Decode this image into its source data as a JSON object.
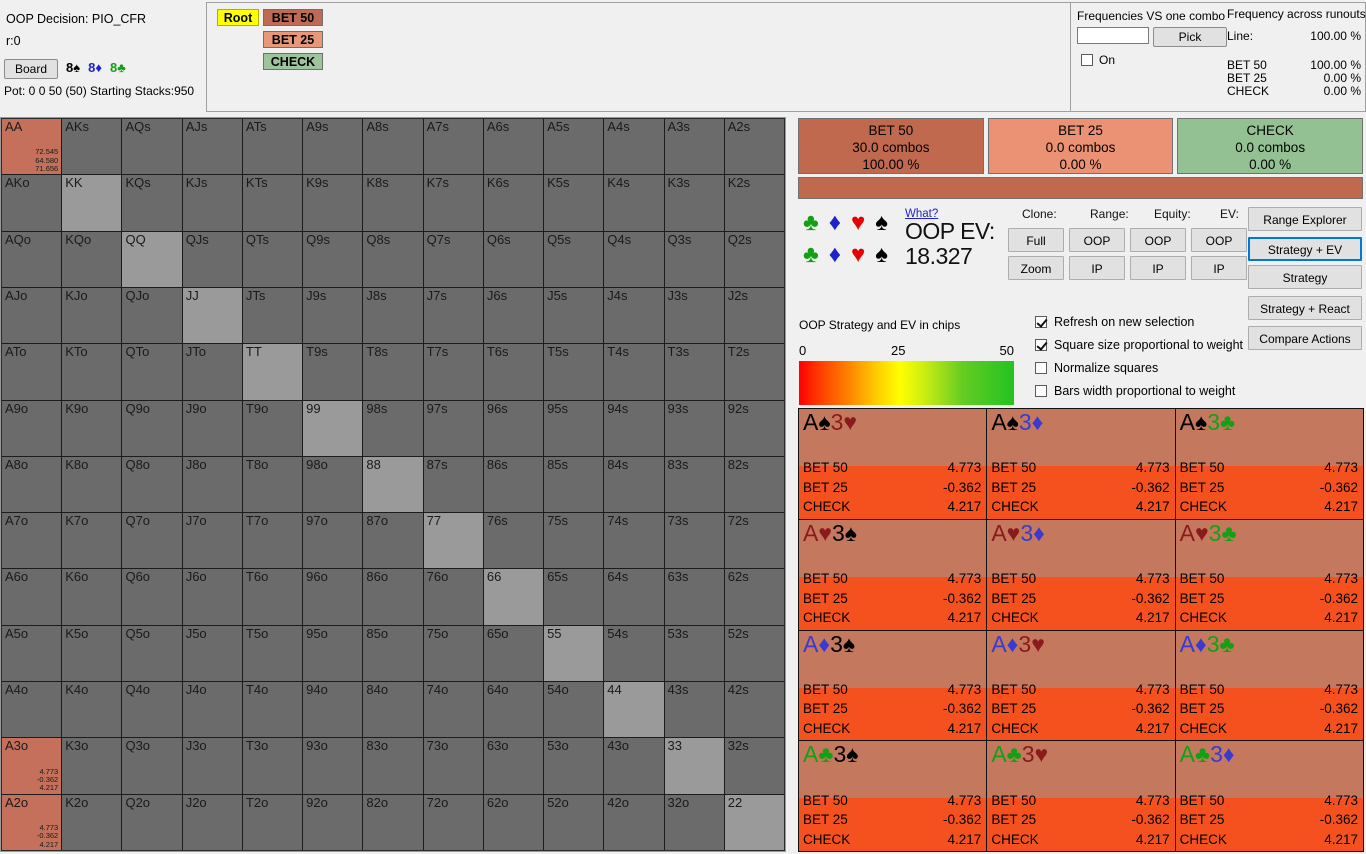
{
  "header": {
    "oop_decision": "OOP Decision:  PIO_CFR",
    "r_line": "r:0",
    "board_button": "Board",
    "board_cards": [
      {
        "rank": "8",
        "suit": "♠",
        "color": "spade"
      },
      {
        "rank": "8",
        "suit": "♦",
        "color": "diamond"
      },
      {
        "rank": "8",
        "suit": "♣",
        "color": "club"
      }
    ],
    "pot_line": "Pot: 0 0 50 (50) Starting Stacks:950"
  },
  "tree": {
    "root": "Root",
    "bet50": "BET 50",
    "bet25": "BET 25",
    "check": "CHECK"
  },
  "frequencies": {
    "vs_one_combo_label": "Frequencies VS one combo",
    "input_value": "",
    "input_placeholder": "",
    "pick_button": "Pick",
    "on_label": "On",
    "on_checked": false,
    "across_runouts_label": "Frequency across runouts:",
    "line_label": "Line:",
    "line_value": "100.00 %",
    "rows": [
      {
        "label": "BET 50",
        "value": "100.00 %"
      },
      {
        "label": "BET 25",
        "value": "0.00 %"
      },
      {
        "label": "CHECK",
        "value": "0.00 %"
      }
    ]
  },
  "action_summary": [
    {
      "name": "BET 50",
      "combos": "30.0 combos",
      "pct": "100.00 %",
      "color": "#c0694f"
    },
    {
      "name": "BET 25",
      "combos": "0.0 combos",
      "pct": "0.00 %",
      "color": "#ea9273"
    },
    {
      "name": "CHECK",
      "combos": "0.0 combos",
      "pct": "0.00 %",
      "color": "#93c193"
    }
  ],
  "ev_panel": {
    "what_link": "What?",
    "oop_ev_label": "OOP EV:",
    "oop_ev_value": "18.327",
    "caption": "OOP Strategy and EV in chips",
    "scale_min": "0",
    "scale_mid": "25",
    "scale_max": "50"
  },
  "column_headers": {
    "clone": "Clone:",
    "range": "Range:",
    "equity": "Equity:",
    "ev": "EV:"
  },
  "grid_buttons": {
    "full": "Full",
    "zoom": "Zoom",
    "range_oop": "OOP",
    "range_ip": "IP",
    "equity_oop": "OOP",
    "equity_ip": "IP",
    "ev_oop": "OOP",
    "ev_ip": "IP"
  },
  "side_buttons": [
    {
      "label": "Range Explorer",
      "selected": false
    },
    {
      "label": "Strategy + EV",
      "selected": true
    },
    {
      "label": "Strategy",
      "selected": false
    },
    {
      "label": "Strategy + React",
      "selected": false
    },
    {
      "label": "Compare Actions",
      "selected": false
    }
  ],
  "checkboxes": [
    {
      "label": "Refresh on new selection",
      "checked": true
    },
    {
      "label": "Square size proportional to weight",
      "checked": true
    },
    {
      "label": "Normalize squares",
      "checked": false
    },
    {
      "label": "Bars width proportional to weight",
      "checked": false
    }
  ],
  "matrix": {
    "rows": [
      [
        "AA",
        "AKs",
        "AQs",
        "AJs",
        "ATs",
        "A9s",
        "A8s",
        "A7s",
        "A6s",
        "A5s",
        "A4s",
        "A3s",
        "A2s"
      ],
      [
        "AKo",
        "KK",
        "KQs",
        "KJs",
        "KTs",
        "K9s",
        "K8s",
        "K7s",
        "K6s",
        "K5s",
        "K4s",
        "K3s",
        "K2s"
      ],
      [
        "AQo",
        "KQo",
        "QQ",
        "QJs",
        "QTs",
        "Q9s",
        "Q8s",
        "Q7s",
        "Q6s",
        "Q5s",
        "Q4s",
        "Q3s",
        "Q2s"
      ],
      [
        "AJo",
        "KJo",
        "QJo",
        "JJ",
        "JTs",
        "J9s",
        "J8s",
        "J7s",
        "J6s",
        "J5s",
        "J4s",
        "J3s",
        "J2s"
      ],
      [
        "ATo",
        "KTo",
        "QTo",
        "JTo",
        "TT",
        "T9s",
        "T8s",
        "T7s",
        "T6s",
        "T5s",
        "T4s",
        "T3s",
        "T2s"
      ],
      [
        "A9o",
        "K9o",
        "Q9o",
        "J9o",
        "T9o",
        "99",
        "98s",
        "97s",
        "96s",
        "95s",
        "94s",
        "93s",
        "92s"
      ],
      [
        "A8o",
        "K8o",
        "Q8o",
        "J8o",
        "T8o",
        "98o",
        "88",
        "87s",
        "86s",
        "85s",
        "84s",
        "83s",
        "82s"
      ],
      [
        "A7o",
        "K7o",
        "Q7o",
        "J7o",
        "T7o",
        "97o",
        "87o",
        "77",
        "76s",
        "75s",
        "74s",
        "73s",
        "72s"
      ],
      [
        "A6o",
        "K6o",
        "Q6o",
        "J6o",
        "T6o",
        "96o",
        "86o",
        "76o",
        "66",
        "65s",
        "64s",
        "63s",
        "62s"
      ],
      [
        "A5o",
        "K5o",
        "Q5o",
        "J5o",
        "T5o",
        "95o",
        "85o",
        "75o",
        "65o",
        "55",
        "54s",
        "53s",
        "52s"
      ],
      [
        "A4o",
        "K4o",
        "Q4o",
        "J4o",
        "T4o",
        "94o",
        "84o",
        "74o",
        "64o",
        "54o",
        "44",
        "43s",
        "42s"
      ],
      [
        "A3o",
        "K3o",
        "Q3o",
        "J3o",
        "T3o",
        "93o",
        "83o",
        "73o",
        "63o",
        "53o",
        "43o",
        "33",
        "32s"
      ],
      [
        "A2o",
        "K2o",
        "Q2o",
        "J2o",
        "T2o",
        "92o",
        "82o",
        "72o",
        "62o",
        "52o",
        "42o",
        "32o",
        "22"
      ]
    ],
    "highlighted": {
      "AA": [
        "72.545",
        "64.580",
        "71.656"
      ],
      "A3o": [
        "4.773",
        "-0.362",
        "4.217"
      ],
      "A2o": [
        "4.773",
        "-0.362",
        "4.217"
      ]
    }
  },
  "combos": [
    {
      "r1": "A",
      "s1": "♠",
      "c1": "spade",
      "r2": "3",
      "s2": "♥",
      "c2": "heart",
      "rows": [
        {
          "l": "BET 50",
          "v": "4.773"
        },
        {
          "l": "BET 25",
          "v": "-0.362"
        },
        {
          "l": "CHECK",
          "v": "4.217"
        }
      ]
    },
    {
      "r1": "A",
      "s1": "♠",
      "c1": "spade",
      "r2": "3",
      "s2": "♦",
      "c2": "diamond",
      "rows": [
        {
          "l": "BET 50",
          "v": "4.773"
        },
        {
          "l": "BET 25",
          "v": "-0.362"
        },
        {
          "l": "CHECK",
          "v": "4.217"
        }
      ]
    },
    {
      "r1": "A",
      "s1": "♠",
      "c1": "spade",
      "r2": "3",
      "s2": "♣",
      "c2": "club",
      "rows": [
        {
          "l": "BET 50",
          "v": "4.773"
        },
        {
          "l": "BET 25",
          "v": "-0.362"
        },
        {
          "l": "CHECK",
          "v": "4.217"
        }
      ]
    },
    {
      "r1": "A",
      "s1": "♥",
      "c1": "heart",
      "r2": "3",
      "s2": "♠",
      "c2": "spade",
      "rows": [
        {
          "l": "BET 50",
          "v": "4.773"
        },
        {
          "l": "BET 25",
          "v": "-0.362"
        },
        {
          "l": "CHECK",
          "v": "4.217"
        }
      ]
    },
    {
      "r1": "A",
      "s1": "♥",
      "c1": "heart",
      "r2": "3",
      "s2": "♦",
      "c2": "diamond",
      "rows": [
        {
          "l": "BET 50",
          "v": "4.773"
        },
        {
          "l": "BET 25",
          "v": "-0.362"
        },
        {
          "l": "CHECK",
          "v": "4.217"
        }
      ]
    },
    {
      "r1": "A",
      "s1": "♥",
      "c1": "heart",
      "r2": "3",
      "s2": "♣",
      "c2": "club",
      "rows": [
        {
          "l": "BET 50",
          "v": "4.773"
        },
        {
          "l": "BET 25",
          "v": "-0.362"
        },
        {
          "l": "CHECK",
          "v": "4.217"
        }
      ]
    },
    {
      "r1": "A",
      "s1": "♦",
      "c1": "diamond",
      "r2": "3",
      "s2": "♠",
      "c2": "spade",
      "rows": [
        {
          "l": "BET 50",
          "v": "4.773"
        },
        {
          "l": "BET 25",
          "v": "-0.362"
        },
        {
          "l": "CHECK",
          "v": "4.217"
        }
      ]
    },
    {
      "r1": "A",
      "s1": "♦",
      "c1": "diamond",
      "r2": "3",
      "s2": "♥",
      "c2": "heart",
      "rows": [
        {
          "l": "BET 50",
          "v": "4.773"
        },
        {
          "l": "BET 25",
          "v": "-0.362"
        },
        {
          "l": "CHECK",
          "v": "4.217"
        }
      ]
    },
    {
      "r1": "A",
      "s1": "♦",
      "c1": "diamond",
      "r2": "3",
      "s2": "♣",
      "c2": "club",
      "rows": [
        {
          "l": "BET 50",
          "v": "4.773"
        },
        {
          "l": "BET 25",
          "v": "-0.362"
        },
        {
          "l": "CHECK",
          "v": "4.217"
        }
      ]
    },
    {
      "r1": "A",
      "s1": "♣",
      "c1": "club",
      "r2": "3",
      "s2": "♠",
      "c2": "spade",
      "rows": [
        {
          "l": "BET 50",
          "v": "4.773"
        },
        {
          "l": "BET 25",
          "v": "-0.362"
        },
        {
          "l": "CHECK",
          "v": "4.217"
        }
      ]
    },
    {
      "r1": "A",
      "s1": "♣",
      "c1": "club",
      "r2": "3",
      "s2": "♥",
      "c2": "heart",
      "rows": [
        {
          "l": "BET 50",
          "v": "4.773"
        },
        {
          "l": "BET 25",
          "v": "-0.362"
        },
        {
          "l": "CHECK",
          "v": "4.217"
        }
      ]
    },
    {
      "r1": "A",
      "s1": "♣",
      "c1": "club",
      "r2": "3",
      "s2": "♦",
      "c2": "diamond",
      "rows": [
        {
          "l": "BET 50",
          "v": "4.773"
        },
        {
          "l": "BET 25",
          "v": "-0.362"
        },
        {
          "l": "CHECK",
          "v": "4.217"
        }
      ]
    }
  ],
  "suit_legend": [
    {
      "suit": "♣",
      "color": "club"
    },
    {
      "suit": "♦",
      "color": "diamond"
    },
    {
      "suit": "♥",
      "color": "heart"
    },
    {
      "suit": "♠",
      "color": "spade"
    }
  ]
}
